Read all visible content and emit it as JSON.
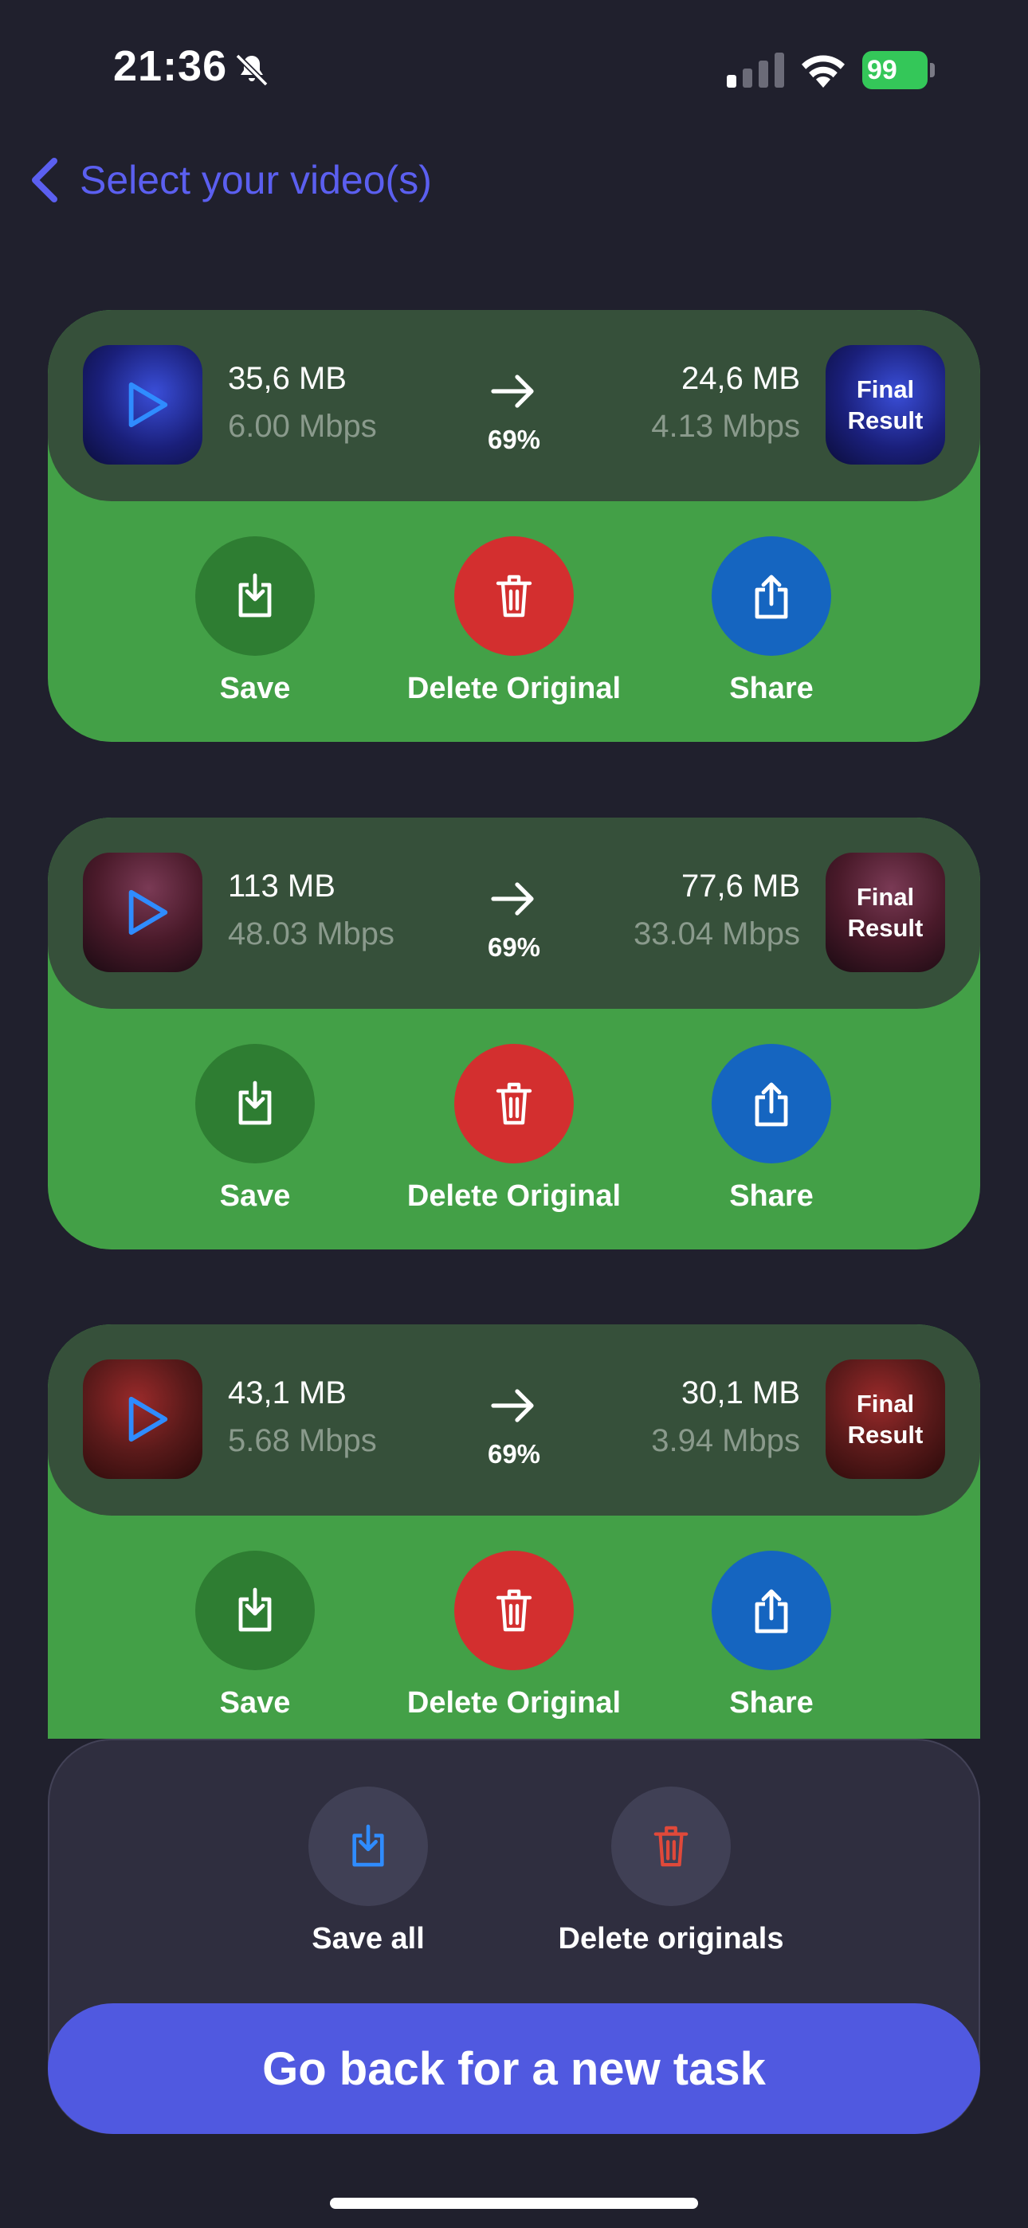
{
  "status": {
    "time": "21:36",
    "battery": "99"
  },
  "nav": {
    "title": "Select your video(s)"
  },
  "cards": [
    {
      "original_size": "35,6 MB",
      "original_rate": "6.00 Mbps",
      "result_size": "24,6 MB",
      "result_rate": "4.13 Mbps",
      "percent": "69%",
      "result_label": "Final\nResult"
    },
    {
      "original_size": "113 MB",
      "original_rate": "48.03 Mbps",
      "result_size": "77,6 MB",
      "result_rate": "33.04 Mbps",
      "percent": "69%",
      "result_label": "Final\nResult"
    },
    {
      "original_size": "43,1 MB",
      "original_rate": "5.68 Mbps",
      "result_size": "30,1 MB",
      "result_rate": "3.94 Mbps",
      "percent": "69%",
      "result_label": "Final\nResult"
    }
  ],
  "actions": {
    "save": "Save",
    "delete": "Delete Original",
    "share": "Share"
  },
  "bulk": {
    "save_all": "Save all",
    "delete_originals": "Delete originals"
  },
  "cta": {
    "label": "Go back for a new task"
  },
  "colors": {
    "background": "#20202d",
    "card_green": "#43a047",
    "panel": "#36503a",
    "save": "#2e7d32",
    "delete": "#d32f2f",
    "share": "#1565c0",
    "accent": "#5059e0"
  },
  "icons": {
    "bell": "bell-slash-icon",
    "back": "chevron-left-icon",
    "play": "play-icon",
    "arrow": "arrow-right-icon",
    "save": "download-icon",
    "delete": "trash-icon",
    "share": "share-icon"
  }
}
